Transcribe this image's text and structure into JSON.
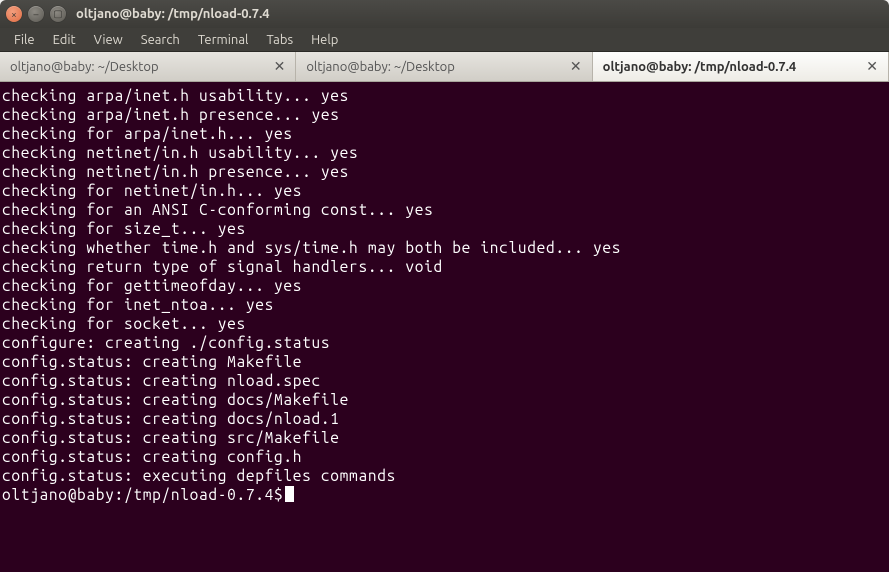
{
  "window": {
    "title": "oltjano@baby: /tmp/nload-0.7.4"
  },
  "menu": {
    "items": [
      "File",
      "Edit",
      "View",
      "Search",
      "Terminal",
      "Tabs",
      "Help"
    ]
  },
  "tabs": [
    {
      "label": "oltjano@baby: ~/Desktop",
      "active": false
    },
    {
      "label": "oltjano@baby: ~/Desktop",
      "active": false
    },
    {
      "label": "oltjano@baby: /tmp/nload-0.7.4",
      "active": true
    }
  ],
  "terminal": {
    "lines": [
      "checking arpa/inet.h usability... yes",
      "checking arpa/inet.h presence... yes",
      "checking for arpa/inet.h... yes",
      "checking netinet/in.h usability... yes",
      "checking netinet/in.h presence... yes",
      "checking for netinet/in.h... yes",
      "checking for an ANSI C-conforming const... yes",
      "checking for size_t... yes",
      "checking whether time.h and sys/time.h may both be included... yes",
      "checking return type of signal handlers... void",
      "checking for gettimeofday... yes",
      "checking for inet_ntoa... yes",
      "checking for socket... yes",
      "configure: creating ./config.status",
      "config.status: creating Makefile",
      "config.status: creating nload.spec",
      "config.status: creating docs/Makefile",
      "config.status: creating docs/nload.1",
      "config.status: creating src/Makefile",
      "config.status: creating config.h",
      "config.status: executing depfiles commands"
    ],
    "prompt": "oltjano@baby:/tmp/nload-0.7.4$"
  }
}
